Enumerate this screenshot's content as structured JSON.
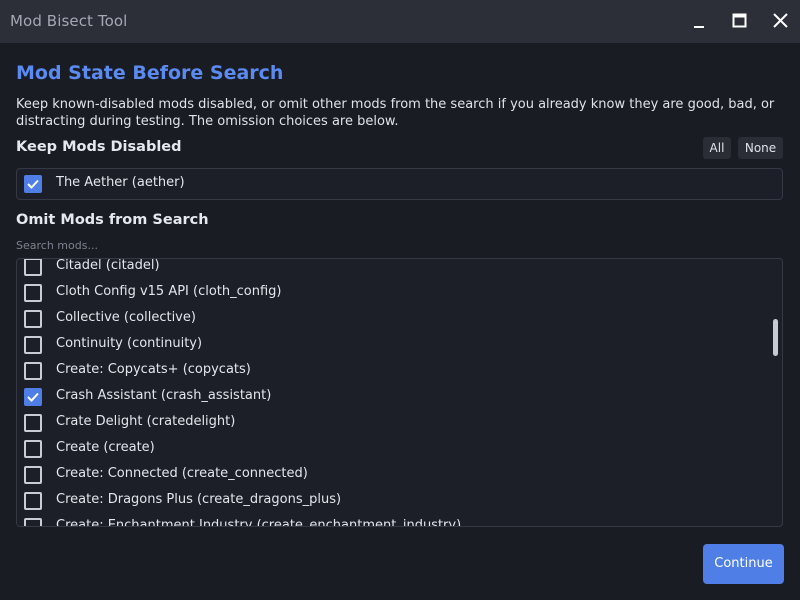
{
  "window": {
    "title": "Mod Bisect Tool",
    "controls": [
      "minimize-icon",
      "maximize-icon",
      "close-icon"
    ]
  },
  "header": {
    "title": "Mod State Before Search",
    "description": "Keep known-disabled mods disabled, or omit other mods from the search if you already know they are good, bad, or distracting during testing. The omission choices are below."
  },
  "keep_disabled": {
    "label": "Keep Mods Disabled",
    "all_label": "All",
    "none_label": "None",
    "items": [
      {
        "label": "The Aether (aether)",
        "checked": true
      }
    ]
  },
  "omit": {
    "label": "Omit Mods from Search",
    "search_placeholder": "Search mods...",
    "items": [
      {
        "label": "Citadel (citadel)",
        "checked": false
      },
      {
        "label": "Cloth Config v15 API (cloth_config)",
        "checked": false
      },
      {
        "label": "Collective (collective)",
        "checked": false
      },
      {
        "label": "Continuity (continuity)",
        "checked": false
      },
      {
        "label": "Create: Copycats+ (copycats)",
        "checked": false
      },
      {
        "label": "Crash Assistant (crash_assistant)",
        "checked": true
      },
      {
        "label": "Crate Delight (cratedelight)",
        "checked": false
      },
      {
        "label": "Create (create)",
        "checked": false
      },
      {
        "label": "Create: Connected (create_connected)",
        "checked": false
      },
      {
        "label": "Create: Dragons Plus (create_dragons_plus)",
        "checked": false
      },
      {
        "label": "Create: Enchantment Industry (create_enchantment_industry)",
        "checked": false
      }
    ]
  },
  "footer": {
    "continue_label": "Continue"
  },
  "colors": {
    "accent": "#4f7fe6",
    "heading": "#5b8af0",
    "background": "#1a1c24",
    "titlebar": "#2c2f37"
  }
}
